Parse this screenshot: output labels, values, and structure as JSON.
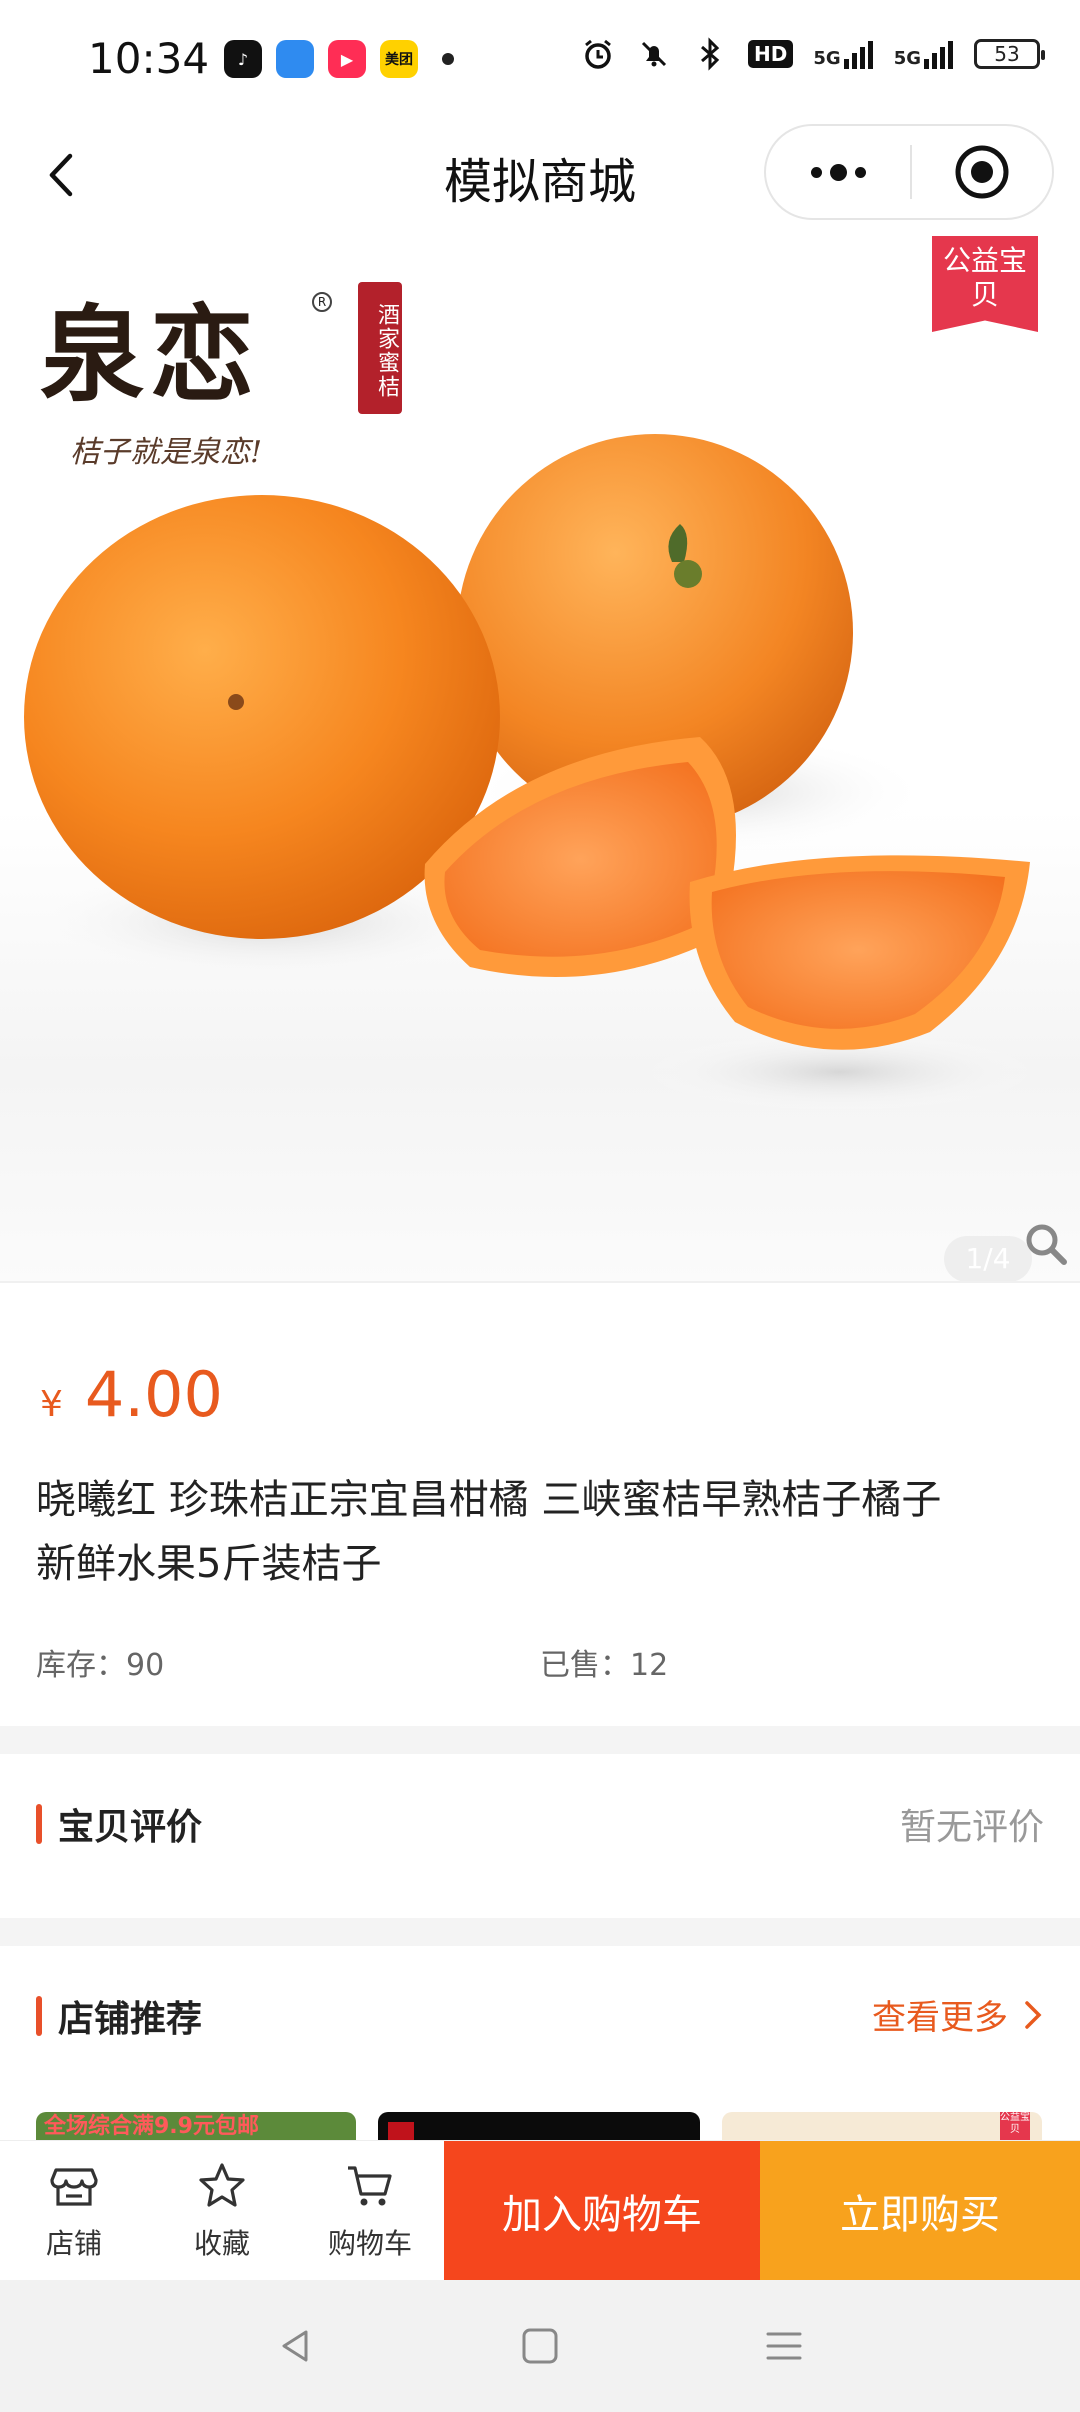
{
  "status_bar": {
    "time": "10:34",
    "apps": [
      {
        "name": "tiktok-icon",
        "color": "#111111",
        "label": "♪"
      },
      {
        "name": "feather-app-icon",
        "color": "#2f8bf0",
        "label": ""
      },
      {
        "name": "video-app-icon",
        "color": "#ff2d55",
        "label": "▶"
      },
      {
        "name": "meituan-icon",
        "color": "#ffd100",
        "label": "美团"
      }
    ],
    "hd_label": "HD",
    "signal1_label": "5G",
    "signal2_label": "5G",
    "battery": "53"
  },
  "nav": {
    "title": "模拟商城"
  },
  "hero": {
    "brand_name": "泉恋",
    "brand_seal": "酒家蜜桔",
    "brand_slogan": "桔子就是泉恋!",
    "charity_tag": "公益宝贝",
    "pager": "1/4"
  },
  "product": {
    "currency": "¥",
    "price": "4.00",
    "title": "晓曦红 珍珠桔正宗宜昌柑橘 三峡蜜桔早熟桔子橘子新鲜水果5斤装桔子",
    "stock": "库存：90",
    "sold": "已售：12"
  },
  "reviews": {
    "title": "宝贝评价",
    "empty_text": "暂无评价"
  },
  "recommend": {
    "title": "店铺推荐",
    "more": "查看更多",
    "card1_text": "全场综合满9.9元包邮",
    "card3_tag": "公益宝贝"
  },
  "bottom_bar": {
    "shop": "店铺",
    "favorite": "收藏",
    "cart": "购物车",
    "add_to_cart": "加入购物车",
    "buy_now": "立即购买"
  },
  "colors": {
    "accent": "#e85a1e",
    "cart_button": "#f5461d",
    "buy_button": "#f8a21d",
    "charity_tag": "#e5374d"
  }
}
